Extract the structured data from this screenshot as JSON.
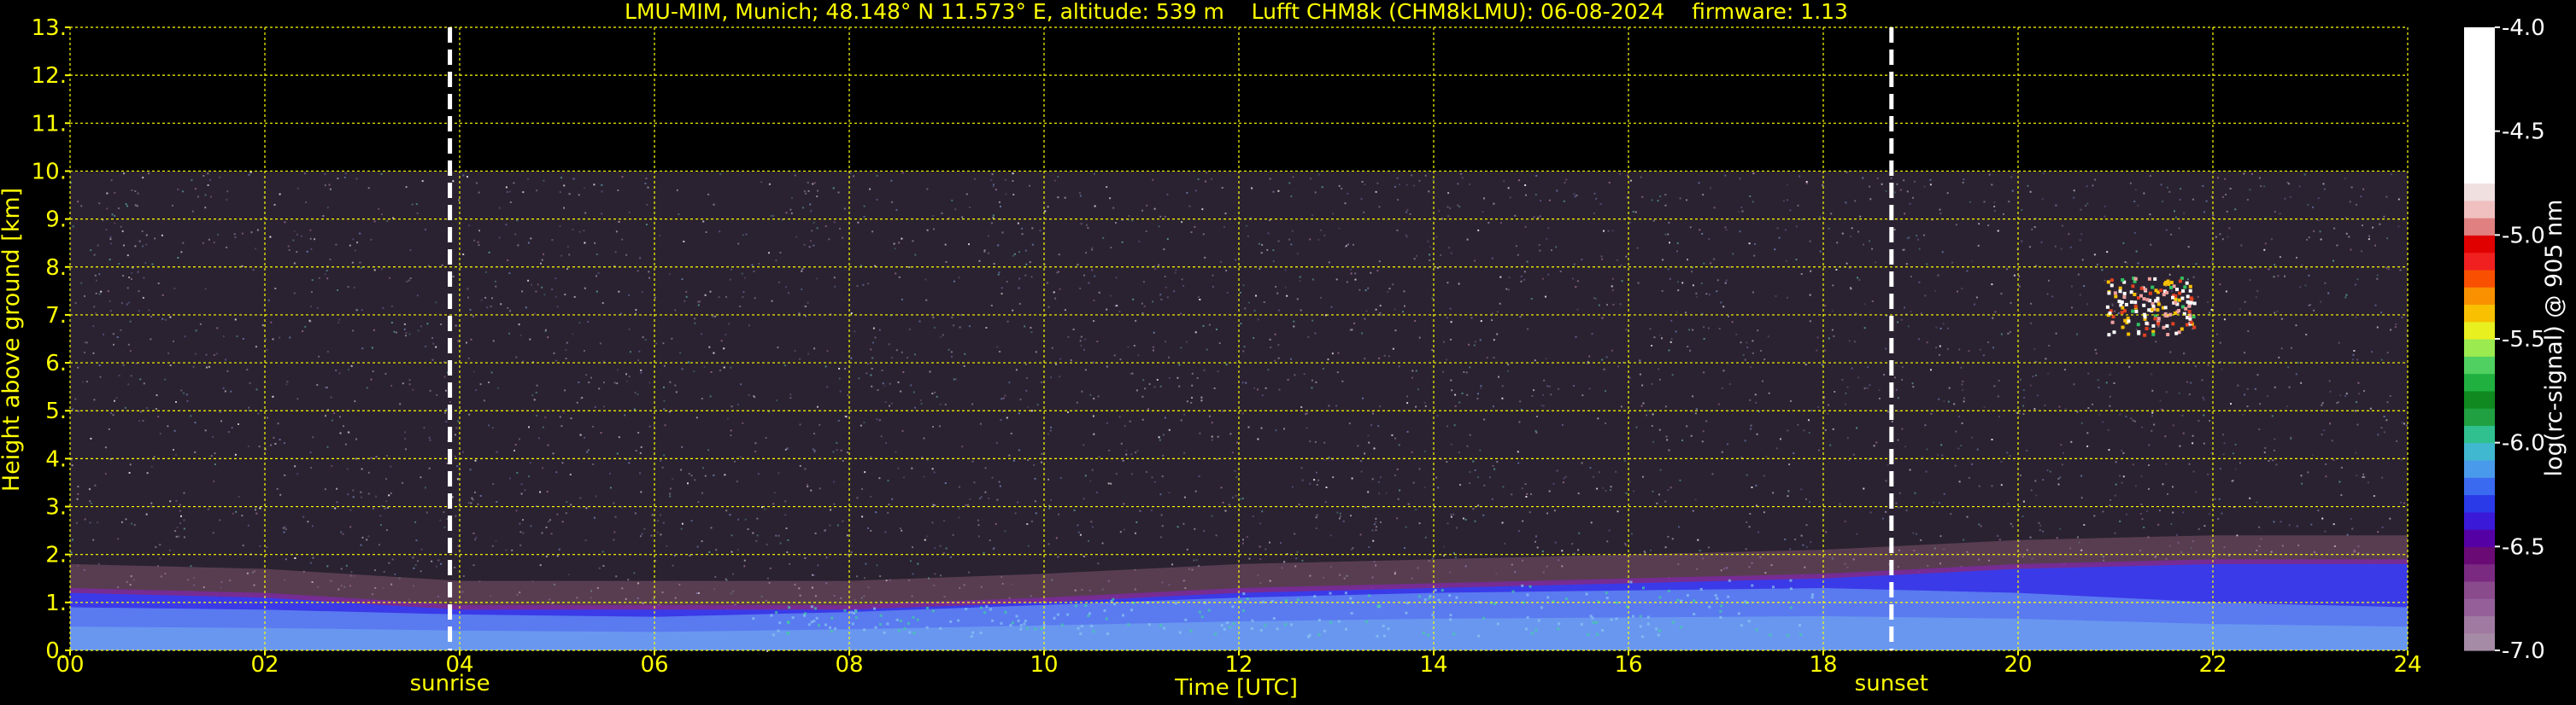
{
  "chart_data": {
    "type": "heatmap",
    "title": "LMU-MIM, Munich; 48.148° N 11.573° E, altitude: 539 m    Lufft CHM8k (CHM8kLMU): 06-08-2024    firmware: 1.13",
    "xlabel": "Time [UTC]",
    "ylabel": "Height above ground [km]",
    "xlim": [
      0,
      24
    ],
    "ylim": [
      0,
      13
    ],
    "x_ticks": [
      0,
      2,
      4,
      6,
      8,
      10,
      12,
      14,
      16,
      18,
      20,
      22,
      24
    ],
    "x_tick_labels": [
      "00",
      "02",
      "04",
      "06",
      "08",
      "10",
      "12",
      "14",
      "16",
      "18",
      "20",
      "22",
      "24"
    ],
    "y_ticks": [
      0,
      1,
      2,
      3,
      4,
      5,
      6,
      7,
      8,
      9,
      10,
      11,
      12,
      13
    ],
    "y_tick_labels": [
      "0.",
      "1.",
      "2.",
      "3.",
      "4.",
      "5.",
      "6.",
      "7.",
      "8.",
      "9.",
      "10.",
      "11.",
      "12.",
      "13."
    ],
    "grid": true,
    "data_top_km": 10,
    "annotations": [
      {
        "label": "sunrise",
        "x": 3.9
      },
      {
        "label": "sunset",
        "x": 18.7
      }
    ],
    "boundary_layer": [
      {
        "t": 0,
        "top": 1.3,
        "mid": 0.9
      },
      {
        "t": 2,
        "top": 1.2,
        "mid": 0.85
      },
      {
        "t": 4,
        "top": 0.95,
        "mid": 0.75
      },
      {
        "t": 6,
        "top": 0.95,
        "mid": 0.7
      },
      {
        "t": 8,
        "top": 0.95,
        "mid": 0.8
      },
      {
        "t": 10,
        "top": 1.1,
        "mid": 0.95
      },
      {
        "t": 12,
        "top": 1.3,
        "mid": 1.1
      },
      {
        "t": 14,
        "top": 1.4,
        "mid": 1.2
      },
      {
        "t": 16,
        "top": 1.5,
        "mid": 1.25
      },
      {
        "t": 18,
        "top": 1.6,
        "mid": 1.3
      },
      {
        "t": 20,
        "top": 1.8,
        "mid": 1.2
      },
      {
        "t": 22,
        "top": 1.9,
        "mid": 1.0
      },
      {
        "t": 24,
        "top": 1.9,
        "mid": 0.9
      }
    ],
    "cloud": {
      "t_start": 20.9,
      "t_end": 21.8,
      "h_bottom": 6.6,
      "h_top": 7.8
    },
    "colorbar": {
      "label": "log(rc-signal) @ 905 nm",
      "range": [
        -7.0,
        -4.0
      ],
      "ticks": [
        -4.0,
        -4.5,
        -5.0,
        -5.5,
        -6.0,
        -6.5,
        -7.0
      ],
      "tick_labels": [
        "-4.0",
        "-4.5",
        "-5.0",
        "-5.5",
        "-6.0",
        "-6.5",
        "-7.0"
      ],
      "colors": [
        "#a58ba5",
        "#a07aa0",
        "#95609a",
        "#8a4b8c",
        "#7a2a80",
        "#6a0a75",
        "#5500a5",
        "#3a1ad8",
        "#2a3ae8",
        "#3a6af0",
        "#4a9aec",
        "#40b8d0",
        "#30c090",
        "#20a040",
        "#108a20",
        "#20b040",
        "#50d060",
        "#9aea50",
        "#e8f020",
        "#f8c000",
        "#f89000",
        "#f85000",
        "#f02020",
        "#e00000",
        "#e08080",
        "#f0c0c0",
        "#f0e0e0",
        "#ffffff",
        "#ffffff",
        "#ffffff",
        "#ffffff",
        "#ffffff",
        "#ffffff",
        "#ffffff",
        "#ffffff",
        "#ffffff"
      ]
    },
    "colors": {
      "text": "#ffff00",
      "grid": "#ffff00",
      "background": "#000000",
      "marker_line": "#ffffff"
    }
  }
}
